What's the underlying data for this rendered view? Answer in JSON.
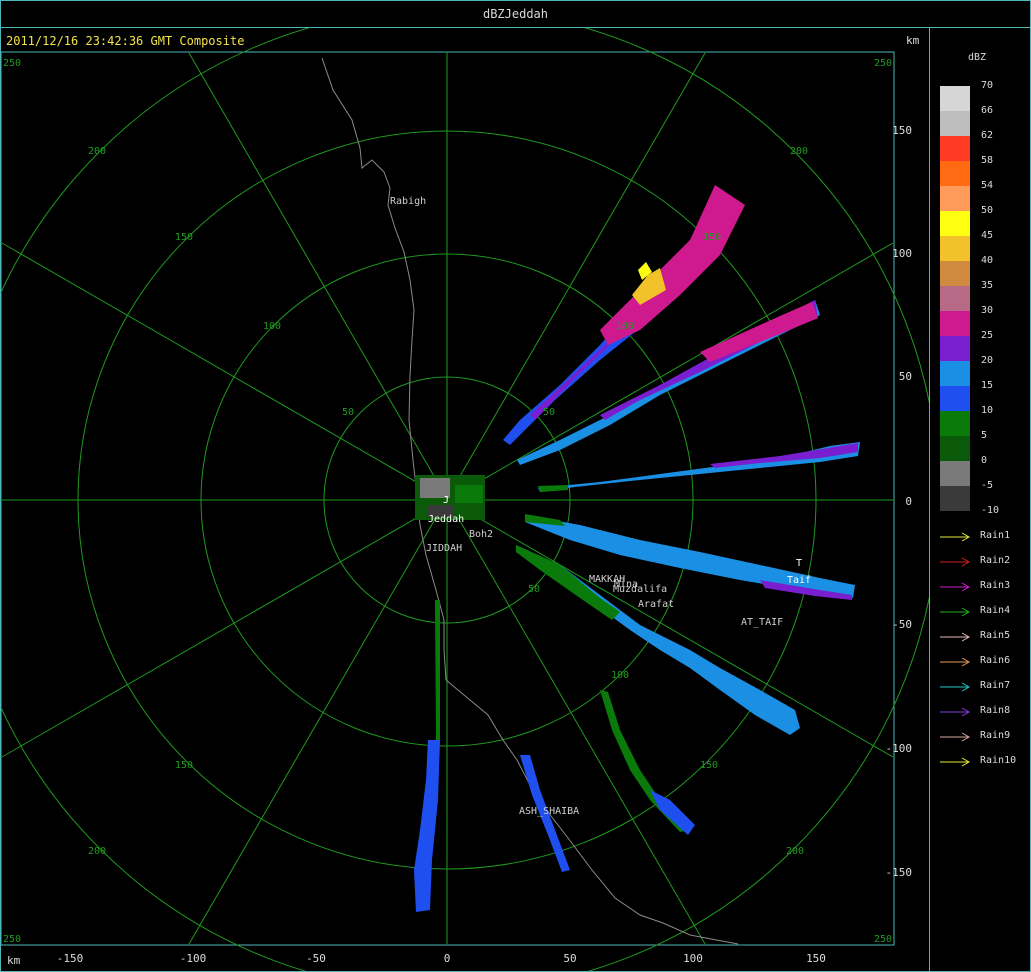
{
  "window": {
    "title": "dBZJeddah"
  },
  "plot": {
    "timestamp_title": "2011/12/16 23:42:36 GMT Composite",
    "unit_top_right": "km",
    "unit_bottom_left": "km",
    "x_ticks": [
      "-150",
      "-100",
      "-50",
      "0",
      "50",
      "100",
      "150"
    ],
    "y_ticks": [
      "150",
      "100",
      "50",
      "0",
      "-50",
      "-100",
      "-150"
    ],
    "range_ring_labels": [
      "50",
      "100",
      "150",
      "200",
      "250"
    ],
    "places": [
      {
        "name": "Rabigh",
        "color": "#d0d0d0"
      },
      {
        "name": "Jeddah",
        "color": "#ffffff"
      },
      {
        "name": "Boh2",
        "color": "#d0d0d0"
      },
      {
        "name": "JIDDAH",
        "color": "#d0d0d0"
      },
      {
        "name": "MAKKAH",
        "color": "#d0d0d0"
      },
      {
        "name": "Mina",
        "color": "#d0d0d0"
      },
      {
        "name": "Muzdalifa",
        "color": "#d0d0d0"
      },
      {
        "name": "Arafat",
        "color": "#d0d0d0"
      },
      {
        "name": "AT_TAIF",
        "color": "#d0d0d0"
      },
      {
        "name": "Taif",
        "color": "#ffffff"
      },
      {
        "name": "ASH_SHAIBA",
        "color": "#d0d0d0"
      },
      {
        "name": "J",
        "color": "#ffffff"
      },
      {
        "name": "T",
        "color": "#ffffff"
      }
    ],
    "colors": {
      "grid": "#1f9a1f",
      "coast": "#8a8a8a",
      "frame": "#4fb7b7"
    }
  },
  "legend": {
    "title": "dBZ",
    "scale": [
      {
        "label": "70",
        "color": "#d6d6d6"
      },
      {
        "label": "66",
        "color": "#bdbdbd"
      },
      {
        "label": "62",
        "color": "#ff3a24"
      },
      {
        "label": "58",
        "color": "#ff6a12"
      },
      {
        "label": "54",
        "color": "#ff9a5a"
      },
      {
        "label": "50",
        "color": "#ffff12"
      },
      {
        "label": "45",
        "color": "#f2c22a"
      },
      {
        "label": "40",
        "color": "#cf8a3f"
      },
      {
        "label": "35",
        "color": "#b66a86"
      },
      {
        "label": "30",
        "color": "#cf1a8f"
      },
      {
        "label": "25",
        "color": "#7a1fcf"
      },
      {
        "label": "20",
        "color": "#1a8fe3"
      },
      {
        "label": "15",
        "color": "#1f4fef"
      },
      {
        "label": "10",
        "color": "#0a7a0a"
      },
      {
        "label": "5",
        "color": "#0a5a0a"
      },
      {
        "label": "0",
        "color": "#7a7a7a"
      },
      {
        "label": "-5",
        "color": "#3a3a3a"
      },
      {
        "label": "-10",
        "color": "#000000"
      }
    ],
    "rain_items": [
      {
        "label": "Rain1",
        "color": "#e8e83a"
      },
      {
        "label": "Rain2",
        "color": "#d02020"
      },
      {
        "label": "Rain3",
        "color": "#d020d0"
      },
      {
        "label": "Rain4",
        "color": "#20b020"
      },
      {
        "label": "Rain5",
        "color": "#e6b8b8"
      },
      {
        "label": "Rain6",
        "color": "#e89a5a"
      },
      {
        "label": "Rain7",
        "color": "#20c8c8"
      },
      {
        "label": "Rain8",
        "color": "#8a3adf"
      },
      {
        "label": "Rain9",
        "color": "#d8a89a"
      },
      {
        "label": "Rain10",
        "color": "#e8e83a"
      }
    ]
  }
}
